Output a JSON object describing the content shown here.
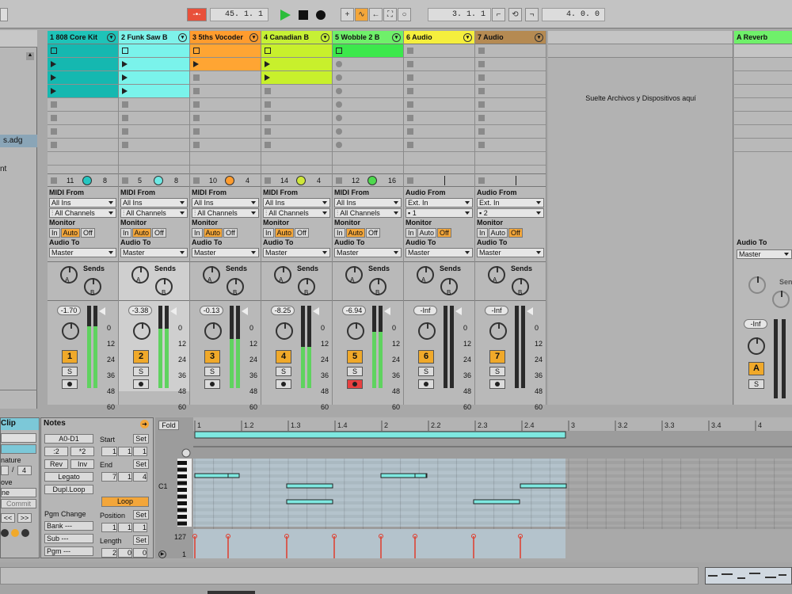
{
  "transport": {
    "tempo_icon": "metronome-icon",
    "position": "45. 1. 1",
    "loop_start": "3. 1. 1",
    "loop_length": "4. 0. 0"
  },
  "browser": {
    "items": [
      "s.adg",
      "nt"
    ]
  },
  "drop_text": "Suelte Archivos y Dispositivos aquí",
  "tracks": [
    {
      "name": "1 808 Core Kit",
      "color": "#1ec3b8",
      "clip_color": "#15b8b0",
      "from_label": "MIDI From",
      "from": "All Ins",
      "ch": "All Channels",
      "vol": "-1.70",
      "num": "1",
      "stat_a": "11",
      "stat_b": "8",
      "led": "#26c6c0",
      "clips": [
        2,
        2,
        2,
        2,
        0,
        0,
        0,
        0
      ],
      "level": 0.75
    },
    {
      "name": "2 Funk Saw B",
      "color": "#7ef2ea",
      "clip_color": "#7af3eb",
      "from_label": "MIDI From",
      "from": "All Ins",
      "ch": "All Channels",
      "vol": "-3.38",
      "num": "2",
      "stat_a": "5",
      "stat_b": "8",
      "led": "#6ee9e4",
      "clips": [
        2,
        1,
        1,
        1,
        0,
        0,
        0,
        0
      ],
      "level": 0.72
    },
    {
      "name": "3 5ths Vocoder",
      "color": "#ff9c2e",
      "clip_color": "#ffa533",
      "from_label": "MIDI From",
      "from": "All Ins",
      "ch": "All Channels",
      "vol": "-0.13",
      "num": "3",
      "stat_a": "10",
      "stat_b": "4",
      "led": "#ff9c2e",
      "clips": [
        2,
        2,
        0,
        0,
        0,
        0,
        0,
        0
      ],
      "level": 0.6
    },
    {
      "name": "4 Canadian B",
      "color": "#c6f035",
      "clip_color": "#c8f02c",
      "from_label": "MIDI From",
      "from": "All Ins",
      "ch": "All Channels",
      "vol": "-8.25",
      "num": "4",
      "stat_a": "14",
      "stat_b": "4",
      "led": "#cfe73a",
      "clips": [
        2,
        2,
        2,
        0,
        0,
        0,
        0,
        0
      ],
      "level": 0.5
    },
    {
      "name": "5 Wobble 2 B",
      "color": "#6ff06a",
      "clip_color": "#3ce84c",
      "from_label": "MIDI From",
      "from": "All Ins",
      "ch": "All Channels",
      "vol": "-6.94",
      "num": "5",
      "stat_a": "12",
      "stat_b": "16",
      "led": "#4dd94d",
      "clips": [
        2,
        3,
        3,
        3,
        3,
        3,
        3,
        3
      ],
      "level": 0.68
    },
    {
      "name": "6 Audio",
      "color": "#f5ef3d",
      "clip_color": "",
      "from_label": "Audio From",
      "from": "Ext. In",
      "ch": "1",
      "vol": "-Inf",
      "num": "6",
      "stat_a": "",
      "stat_b": "",
      "led": "",
      "clips": [
        0,
        0,
        0,
        0,
        0,
        0,
        0,
        0
      ],
      "level": 0
    },
    {
      "name": "7 Audio",
      "color": "#b58a52",
      "clip_color": "",
      "from_label": "Audio From",
      "from": "Ext. In",
      "ch": "2",
      "vol": "-Inf",
      "num": "7",
      "stat_a": "",
      "stat_b": "",
      "led": "",
      "clips": [
        0,
        0,
        0,
        0,
        0,
        0,
        0,
        0
      ],
      "level": 0
    }
  ],
  "labels": {
    "monitor": "Monitor",
    "in": "In",
    "auto": "Auto",
    "off": "Off",
    "audio_to": "Audio To",
    "master": "Master",
    "sends": "Sends",
    "knob_a": "A",
    "knob_b": "B",
    "solo": "S",
    "fold": "Fold",
    "c1": "C1",
    "vel_max": "127",
    "vel_min": "1"
  },
  "scale": [
    "0",
    "12",
    "24",
    "36",
    "48",
    "60"
  ],
  "return": {
    "name": "A Reverb",
    "color": "#6ff06a",
    "audio_to": "Audio To",
    "master": "Master",
    "vol": "-Inf",
    "num": "A",
    "sends": "Sends"
  },
  "clip": {
    "title": "Clip",
    "nature": "nature",
    "sig_den": "4",
    "ove": "ove",
    "commit": "Commit",
    "ne": "ne"
  },
  "notes": {
    "title": "Notes",
    "range": "A0-D1",
    "div": ":2",
    "mul": "*2",
    "rev": "Rev",
    "inv": "Inv",
    "legato": "Legato",
    "dupl": "Dupl.Loop",
    "start": "Start",
    "set": "Set",
    "start_v": [
      "1",
      "1",
      "1"
    ],
    "end": "End",
    "end_v": [
      "7",
      "1",
      "4"
    ],
    "loop": "Loop",
    "position": "Position",
    "pos_v": [
      "1",
      "1",
      "1"
    ],
    "length": "Length",
    "len_v": [
      "2",
      "0",
      "0"
    ],
    "pgm_change": "Pgm Change",
    "bank": "Bank ---",
    "sub": "Sub ---",
    "pgm": "Pgm ---"
  },
  "ruler": [
    "1",
    "1.2",
    "1.3",
    "1.4",
    "2",
    "2.2",
    "2.3",
    "2.4",
    "3",
    "3.2",
    "3.3",
    "3.4",
    "4"
  ]
}
